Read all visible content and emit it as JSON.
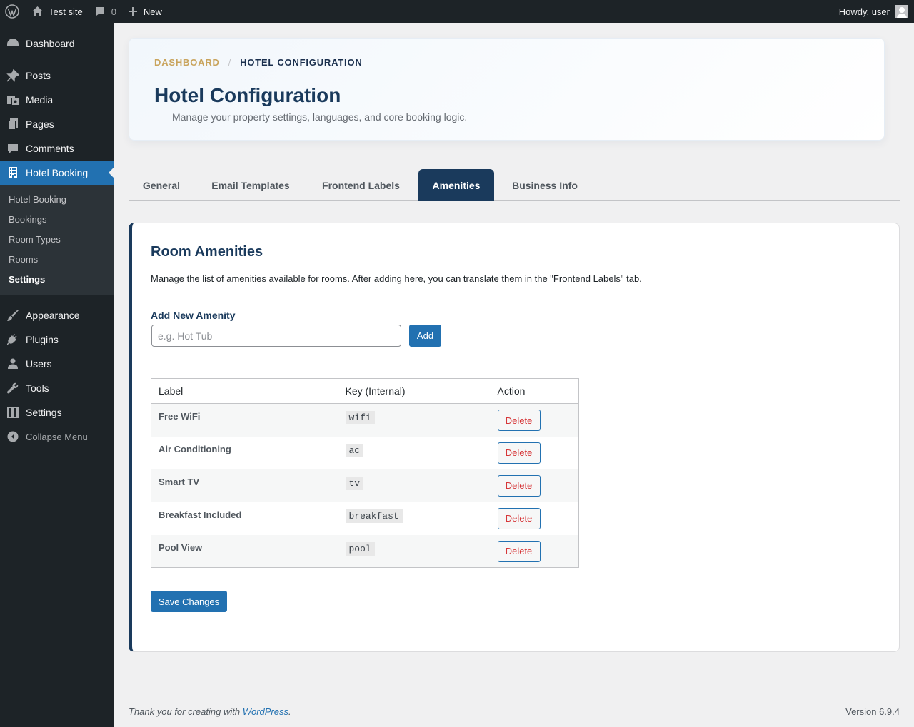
{
  "adminbar": {
    "site_name": "Test site",
    "comments_count": "0",
    "new_label": "New",
    "howdy": "Howdy, user"
  },
  "sidebar": {
    "items_top": [
      {
        "label": "Dashboard",
        "icon": "dashboard-icon"
      },
      {
        "label": "Posts",
        "icon": "pushpin-icon"
      },
      {
        "label": "Media",
        "icon": "media-icon"
      },
      {
        "label": "Pages",
        "icon": "pages-icon"
      },
      {
        "label": "Comments",
        "icon": "comment-icon"
      },
      {
        "label": "Hotel Booking",
        "icon": "building-icon"
      }
    ],
    "submenu": [
      "Hotel Booking",
      "Bookings",
      "Room Types",
      "Rooms",
      "Settings"
    ],
    "items_bottom": [
      {
        "label": "Appearance",
        "icon": "brush-icon"
      },
      {
        "label": "Plugins",
        "icon": "plugin-icon"
      },
      {
        "label": "Users",
        "icon": "users-icon"
      },
      {
        "label": "Tools",
        "icon": "wrench-icon"
      },
      {
        "label": "Settings",
        "icon": "settings-icon"
      }
    ],
    "collapse": "Collapse Menu"
  },
  "header": {
    "breadcrumb_link": "DASHBOARD",
    "breadcrumb_sep": "/",
    "breadcrumb_current": "HOTEL CONFIGURATION",
    "title": "Hotel Configuration",
    "subtitle": "Manage your property settings, languages, and core booking logic."
  },
  "tabs": [
    "General",
    "Email Templates",
    "Frontend Labels",
    "Amenities",
    "Business Info"
  ],
  "panel": {
    "title": "Room Amenities",
    "description": "Manage the list of amenities available for rooms. After adding here, you can translate them in the \"Frontend Labels\" tab.",
    "add_label": "Add New Amenity",
    "add_placeholder": "e.g. Hot Tub",
    "add_button": "Add",
    "table": {
      "headers": [
        "Label",
        "Key (Internal)",
        "Action"
      ],
      "rows": [
        {
          "label": "Free WiFi",
          "key": "wifi",
          "action": "Delete"
        },
        {
          "label": "Air Conditioning",
          "key": "ac",
          "action": "Delete"
        },
        {
          "label": "Smart TV",
          "key": "tv",
          "action": "Delete"
        },
        {
          "label": "Breakfast Included",
          "key": "breakfast",
          "action": "Delete"
        },
        {
          "label": "Pool View",
          "key": "pool",
          "action": "Delete"
        }
      ]
    },
    "save_button": "Save Changes"
  },
  "footer": {
    "thanks_prefix": "Thank you for creating with ",
    "thanks_link": "WordPress",
    "thanks_suffix": ".",
    "version": "Version 6.9.4"
  },
  "colors": {
    "adminbar_bg": "#1d2327",
    "accent_blue": "#2271b1",
    "navy": "#1a3a5c",
    "gold": "#c9a45c",
    "delete_red": "#d63638"
  }
}
